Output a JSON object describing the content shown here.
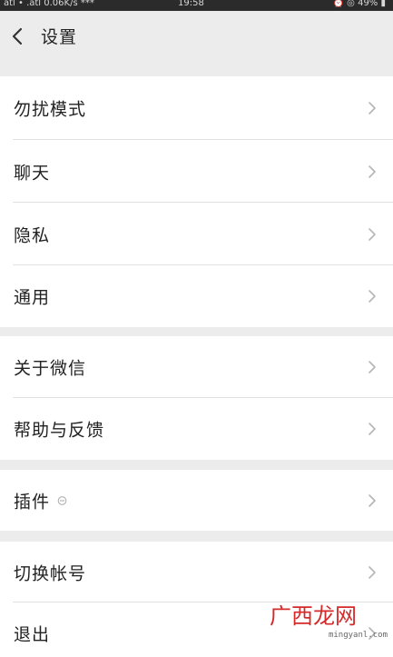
{
  "status_bar": {
    "left": "atl • .atl 0.06K/s ***",
    "time": "19:58",
    "right": "⏰ ◎ 49% ▮"
  },
  "nav": {
    "back_icon": "chevron-left-icon",
    "title": "设置"
  },
  "groups": [
    {
      "items": [
        {
          "label": "勿扰模式"
        },
        {
          "label": "聊天"
        },
        {
          "label": "隐私"
        },
        {
          "label": "通用"
        }
      ]
    },
    {
      "items": [
        {
          "label": "关于微信"
        },
        {
          "label": "帮助与反馈"
        }
      ]
    },
    {
      "items": [
        {
          "label": "插件",
          "badge_icon": "plugin-icon"
        }
      ]
    },
    {
      "items": [
        {
          "label": "切换帐号"
        },
        {
          "label": "退出"
        }
      ]
    }
  ],
  "watermark": {
    "text": "广西龙网",
    "url": "mingyanl.com"
  }
}
